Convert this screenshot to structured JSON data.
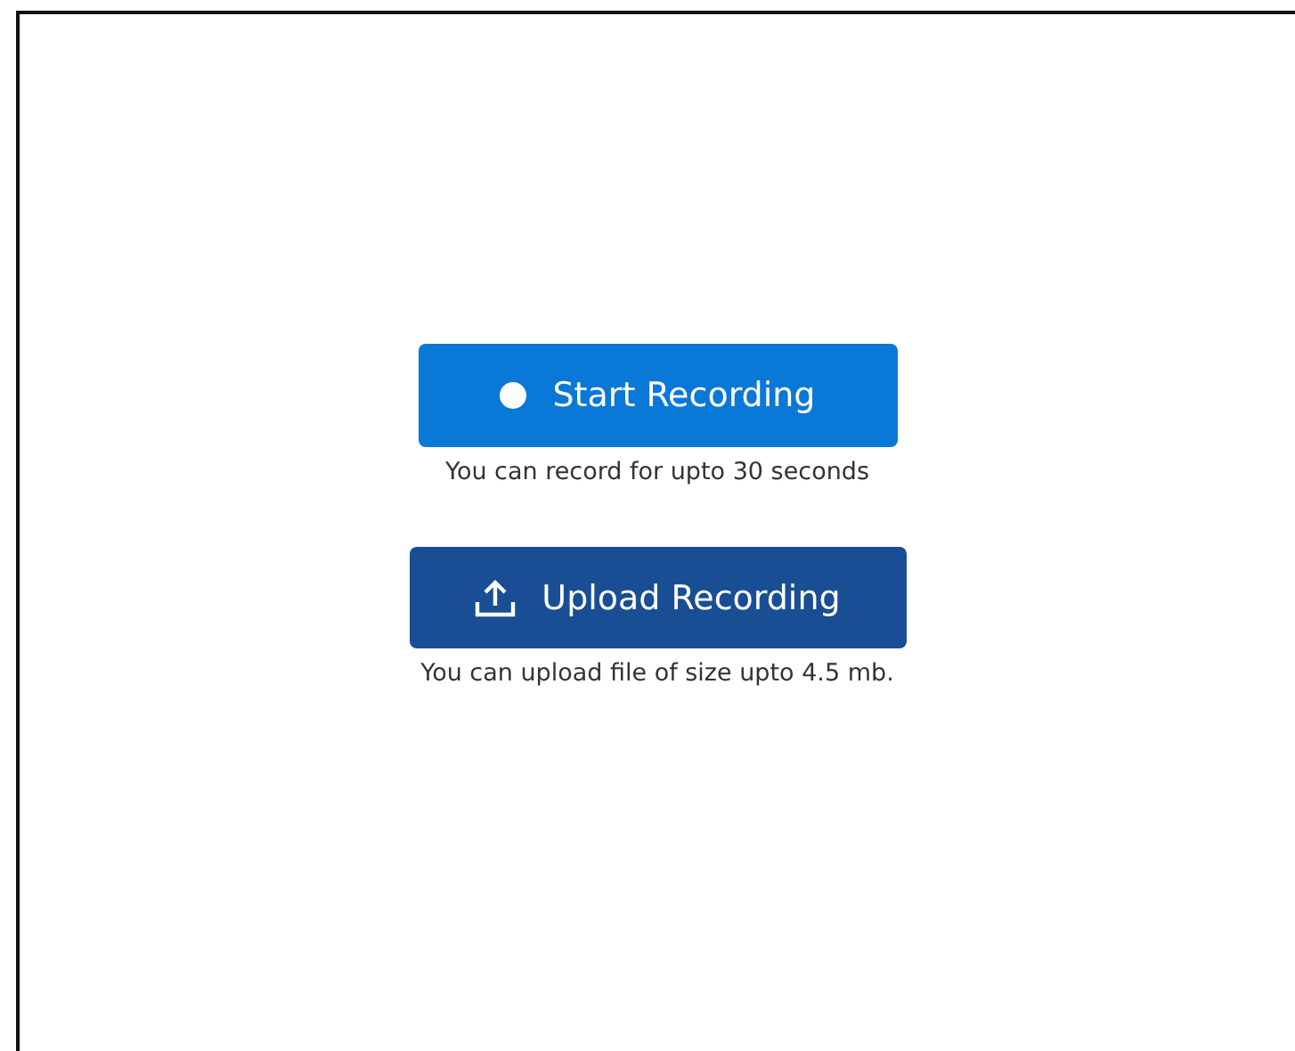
{
  "actions": [
    {
      "kind": "record",
      "label": "Start Recording",
      "hint": "You can record for upto 30 seconds"
    },
    {
      "kind": "upload",
      "label": "Upload Recording",
      "hint": "You can upload file of size upto 4.5 mb."
    }
  ]
}
